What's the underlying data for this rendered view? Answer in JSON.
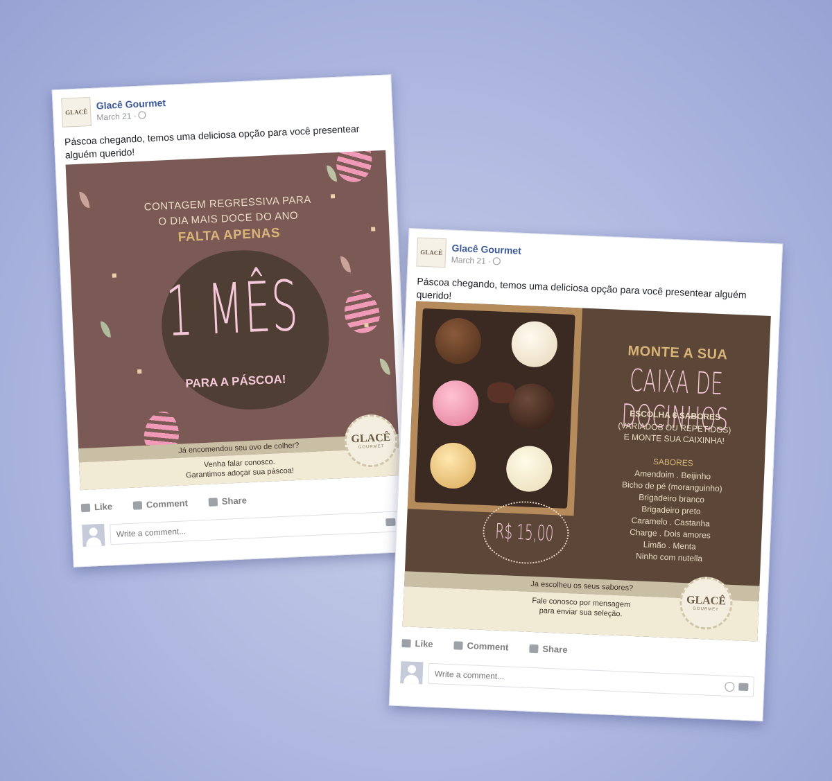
{
  "post1": {
    "page_name": "Glacê Gourmet",
    "date": "March 21 ·",
    "avatar_text": "GLACÊ",
    "message": "Páscoa chegando, temos uma deliciosa opção para você presentear alguém querido!",
    "image": {
      "line1": "CONTAGEM REGRESSIVA PARA",
      "line2": "O DIA MAIS DOCE DO ANO",
      "falta": "FALTA APENAS",
      "big": "1 MÊS",
      "para": "PARA A PÁSCOA!",
      "band_question": "Já encomendou seu ovo de colher?",
      "band_line1": "Venha falar conosco.",
      "band_line2": "Garantimos adoçar sua páscoa!",
      "seal_brand": "GLACÊ",
      "seal_sub": "GOURMET"
    },
    "actions": {
      "like": "Like",
      "comment": "Comment",
      "share": "Share"
    },
    "comment_placeholder": "Write a comment..."
  },
  "post2": {
    "page_name": "Glacê Gourmet",
    "date": "March 21 ·",
    "avatar_text": "GLACÊ",
    "message": "Páscoa chegando, temos uma deliciosa opção para você presentear alguém querido!",
    "image": {
      "monte": "MONTE A SUA",
      "caixa": "CAIXA DE DOCINHOS",
      "escolha": "ESCOLHA 6 SABORES",
      "variados": "(VARIADOS OU REPETIDOS)",
      "monte_sua": "E MONTE SUA CAIXINHA!",
      "sabores_title": "SABORES",
      "flavors": [
        "Amendoim . Beijinho",
        "Bicho de pé (moranguinho)",
        "Brigadeiro branco",
        "Brigadeiro preto",
        "Caramelo . Castanha",
        "Charge . Dois amores",
        "Limão . Menta",
        "Ninho com nutella"
      ],
      "price": "R$ 15,00",
      "band_question": "Ja escolheu os seus sabores?",
      "band_line1": "Fale conosco por mensagem",
      "band_line2": "para enviar sua seleção.",
      "seal_brand": "GLACÊ",
      "seal_sub": "GOURMET"
    },
    "actions": {
      "like": "Like",
      "comment": "Comment",
      "share": "Share"
    },
    "comment_placeholder": "Write a comment..."
  }
}
